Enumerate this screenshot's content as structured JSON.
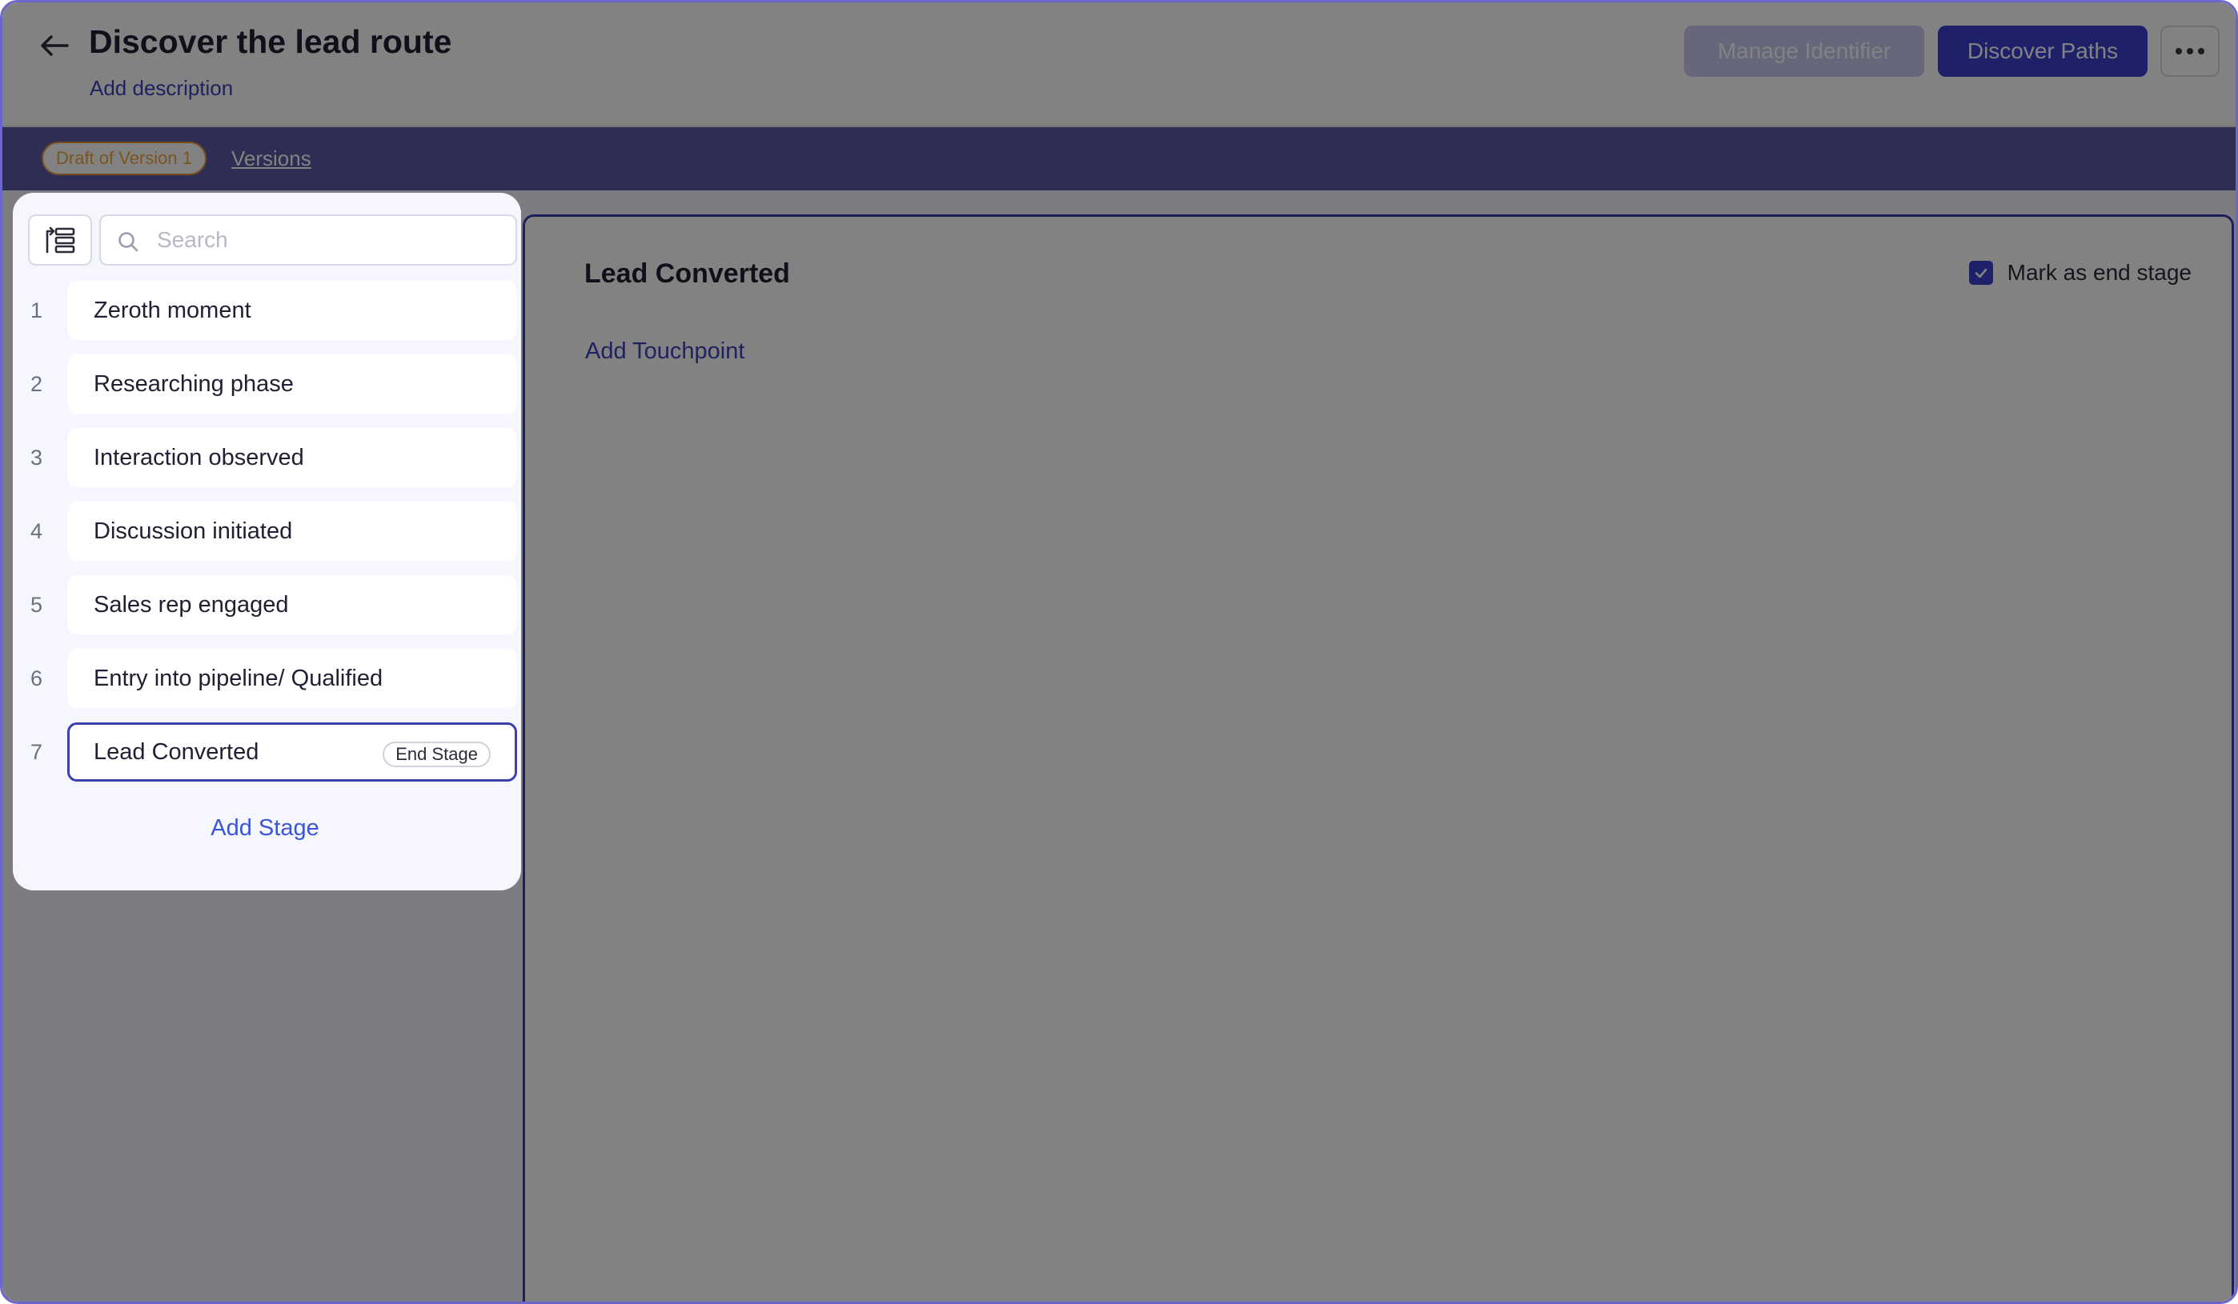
{
  "header": {
    "title": "Discover the lead route",
    "add_description": "Add description",
    "manage_identifier": "Manage Identifier",
    "discover_paths": "Discover Paths"
  },
  "version_bar": {
    "draft_badge": "Draft of Version 1",
    "versions_link": "Versions"
  },
  "sidebar": {
    "search_placeholder": "Search",
    "stages": [
      {
        "num": "1",
        "label": "Zeroth moment"
      },
      {
        "num": "2",
        "label": "Researching phase"
      },
      {
        "num": "3",
        "label": "Interaction observed"
      },
      {
        "num": "4",
        "label": "Discussion initiated"
      },
      {
        "num": "5",
        "label": "Sales rep engaged"
      },
      {
        "num": "6",
        "label": "Entry into pipeline/ Qualified"
      },
      {
        "num": "7",
        "label": "Lead Converted",
        "tag": "End Stage",
        "selected": true
      }
    ],
    "add_stage": "Add Stage"
  },
  "main": {
    "stage_title": "Lead Converted",
    "mark_end_label": "Mark as end stage",
    "mark_end_checked": true,
    "add_touchpoint": "Add Touchpoint"
  },
  "colors": {
    "accent": "#3c3fd0",
    "link": "#3b44b8",
    "draft_badge": "#e79a3a",
    "version_bar": "#5b5ba7"
  },
  "icons": {
    "back": "arrow-left-icon",
    "more": "more-horizontal-icon",
    "tree": "tree-structure-icon",
    "search": "search-icon",
    "check": "check-icon"
  }
}
